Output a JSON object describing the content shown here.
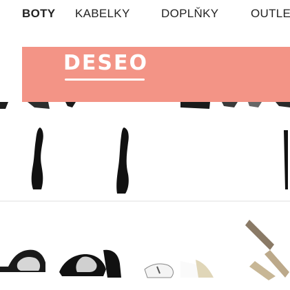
{
  "nav": {
    "items": [
      {
        "label": "BOTY",
        "active": true
      },
      {
        "label": "KABELKY",
        "active": false
      },
      {
        "label": "DOPLŇKY",
        "active": false
      },
      {
        "label": "OUTLE",
        "active": false
      }
    ]
  },
  "banner": {
    "logo_text": "DESEO",
    "color": "#f39486"
  },
  "gallery": {
    "prev_icon": "chevron-left-icon"
  }
}
